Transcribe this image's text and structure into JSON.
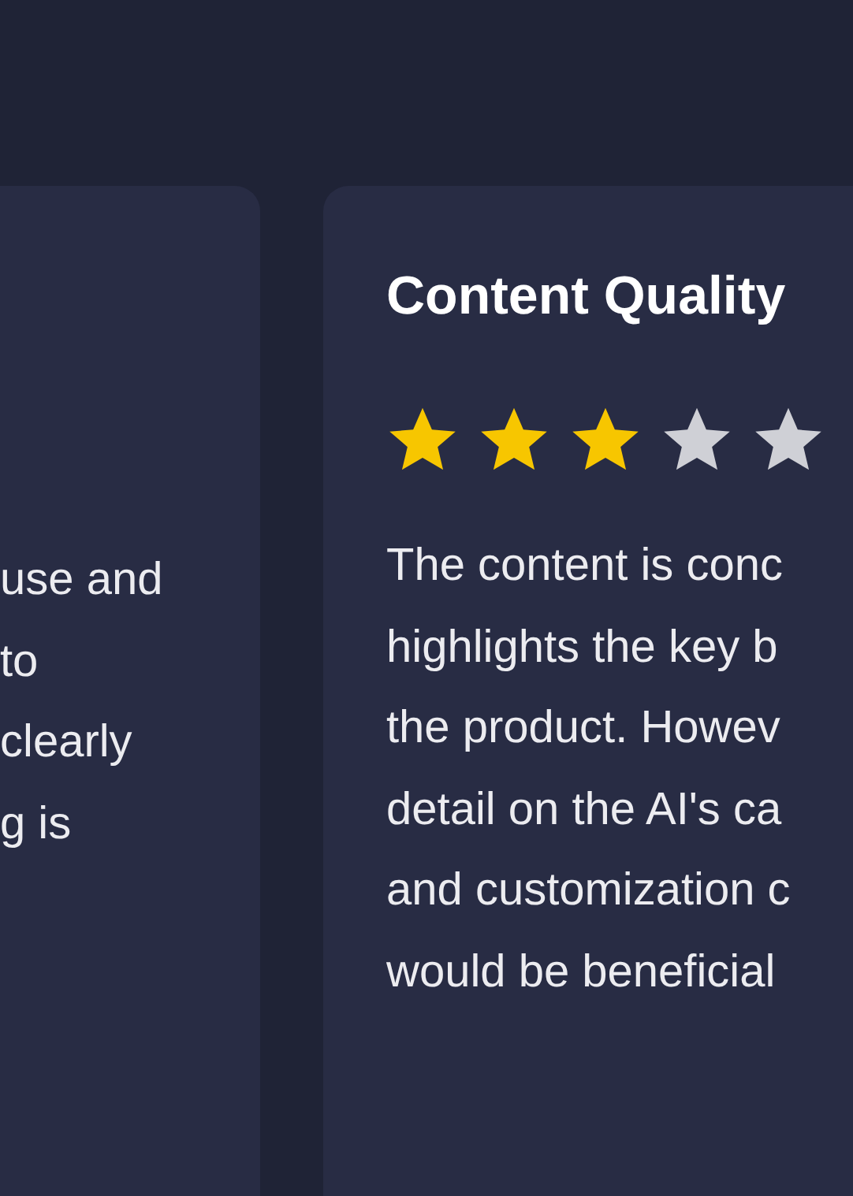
{
  "cards": [
    {
      "lines": [
        "use and",
        "to",
        "clearly",
        "g is"
      ]
    },
    {
      "title": "Content Quality",
      "stars": 3,
      "lines": [
        "The content is conc",
        "highlights the key b",
        "the product. Howev",
        "detail on the AI's ca",
        "and customization c",
        "would be beneficial"
      ]
    }
  ]
}
